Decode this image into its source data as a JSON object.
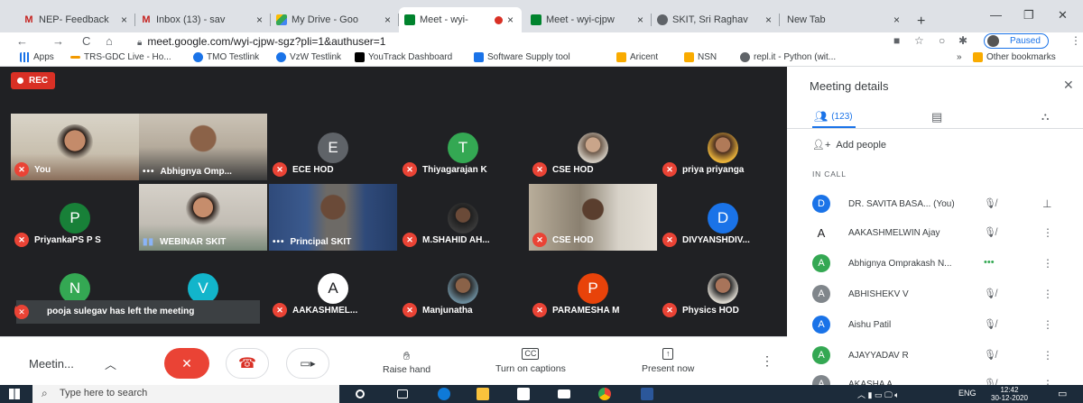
{
  "browser": {
    "tabs": [
      {
        "label": "NEP- Feedback",
        "icon": "gmail-icon",
        "color": "#c5221f"
      },
      {
        "label": "Inbox (13) - sav",
        "icon": "gmail-icon",
        "color": "#c5221f"
      },
      {
        "label": "My Drive - Goo",
        "icon": "drive-icon",
        "color": "#188038"
      },
      {
        "label": "Meet - wyi-",
        "icon": "meet-icon",
        "color": "#00832d"
      },
      {
        "label": "Meet - wyi-cjpw",
        "icon": "meet-icon",
        "color": "#00832d"
      },
      {
        "label": "SKIT, Sri Raghav",
        "icon": "site-icon",
        "color": "#5f6368"
      },
      {
        "label": "New Tab",
        "icon": "",
        "color": "#5f6368"
      }
    ],
    "url": "meet.google.com/wyi-cjpw-sgz?pli=1&authuser=1",
    "profile_status": "Paused",
    "bookmarks": [
      {
        "label": "Apps",
        "icon": "apps-icon",
        "color": "#1a73e8"
      },
      {
        "label": "TRS-GDC Live - Ho...",
        "icon": "trs-icon",
        "color": "#f29900"
      },
      {
        "label": "TMO Testlink",
        "icon": "testlink-icon",
        "color": "#1a73e8"
      },
      {
        "label": "VzW Testlink",
        "icon": "testlink-icon",
        "color": "#1a73e8"
      },
      {
        "label": "YouTrack Dashboard",
        "icon": "youtrack-icon",
        "color": "#000000"
      },
      {
        "label": "Software Supply tool",
        "icon": "n-icon",
        "color": "#1a73e8"
      },
      {
        "label": "Aricent",
        "icon": "folder-icon",
        "color": "#f9ab00"
      },
      {
        "label": "NSN",
        "icon": "folder-icon",
        "color": "#f9ab00"
      },
      {
        "label": "repl.it - Python (wit...",
        "icon": "replit-icon",
        "color": "#5f6368"
      }
    ],
    "overflow": "»",
    "other_bookmarks": "Other bookmarks"
  },
  "meet": {
    "rec_label": "REC",
    "tiles": [
      {
        "name": "You",
        "type": "video",
        "muted": true
      },
      {
        "name": "Abhignya Omp...",
        "type": "video",
        "muted": false
      },
      {
        "name": "ECE HOD",
        "type": "initial",
        "initial": "E",
        "color": "#5f6368",
        "muted": true
      },
      {
        "name": "Thiyagarajan K",
        "type": "initial",
        "initial": "T",
        "color": "#34a853",
        "muted": true
      },
      {
        "name": "CSE HOD",
        "type": "photo",
        "muted": true
      },
      {
        "name": "priya priyanga",
        "type": "photo",
        "muted": true
      },
      {
        "name": "PriyankaPS P S",
        "type": "initial",
        "initial": "P",
        "color": "#188038",
        "muted": true
      },
      {
        "name": "WEBINAR SKIT",
        "type": "video",
        "muted": false,
        "speaking": true
      },
      {
        "name": "Principal SKIT",
        "type": "video",
        "muted": false
      },
      {
        "name": "M.SHAHID AH...",
        "type": "photo",
        "muted": true
      },
      {
        "name": "CSE HOD",
        "type": "video",
        "muted": true
      },
      {
        "name": "DIVYANSHDIV...",
        "type": "initial",
        "initial": "D",
        "color": "#1a73e8",
        "muted": true
      },
      {
        "name": "",
        "type": "initial",
        "initial": "N",
        "color": "#34a853",
        "muted": true
      },
      {
        "name": "",
        "type": "initial",
        "initial": "V",
        "color": "#12b5cb",
        "muted": true
      },
      {
        "name": "AAKASHMEL...",
        "type": "initial",
        "initial": "A",
        "color": "#ffffff",
        "muted": true
      },
      {
        "name": "Manjunatha",
        "type": "photo",
        "muted": true
      },
      {
        "name": "PARAMESHA M",
        "type": "initial",
        "initial": "P",
        "color": "#e8430a",
        "muted": true
      },
      {
        "name": "Physics HOD",
        "type": "photo",
        "muted": true
      }
    ],
    "left_notice": "pooja sulegav has left the meeting",
    "bottom": {
      "meeting_title": "Meetin...",
      "raise_hand": "Raise hand",
      "captions": "Turn on captions",
      "present": "Present now"
    }
  },
  "panel": {
    "title": "Meeting details",
    "people_count": "(123)",
    "add_people": "Add people",
    "section": "IN CALL",
    "people": [
      {
        "initial": "D",
        "name": "DR. SAVITA BASA...",
        "suffix": "(You)",
        "color": "#1a73e8",
        "status": "muted"
      },
      {
        "initial": "A",
        "name": "AAKASHMELWIN Ajay",
        "suffix": "",
        "color": "#ffffff",
        "status": "muted"
      },
      {
        "initial": "A",
        "name": "Abhignya Omprakash N...",
        "suffix": "",
        "color": "#34a853",
        "status": "speaking"
      },
      {
        "initial": "A",
        "name": "ABHISHEKV V",
        "suffix": "",
        "color": "#80868b",
        "status": "muted"
      },
      {
        "initial": "A",
        "name": "Aishu Patil",
        "suffix": "",
        "color": "#1a73e8",
        "status": "muted"
      },
      {
        "initial": "A",
        "name": "AJAYYADAV R",
        "suffix": "",
        "color": "#34a853",
        "status": "muted"
      },
      {
        "initial": "A",
        "name": "AKASHA A",
        "suffix": "",
        "color": "#80868b",
        "status": "muted"
      }
    ]
  },
  "taskbar": {
    "search_placeholder": "Type here to search",
    "lang": "ENG",
    "time": "12:42",
    "date": "30-12-2020"
  }
}
